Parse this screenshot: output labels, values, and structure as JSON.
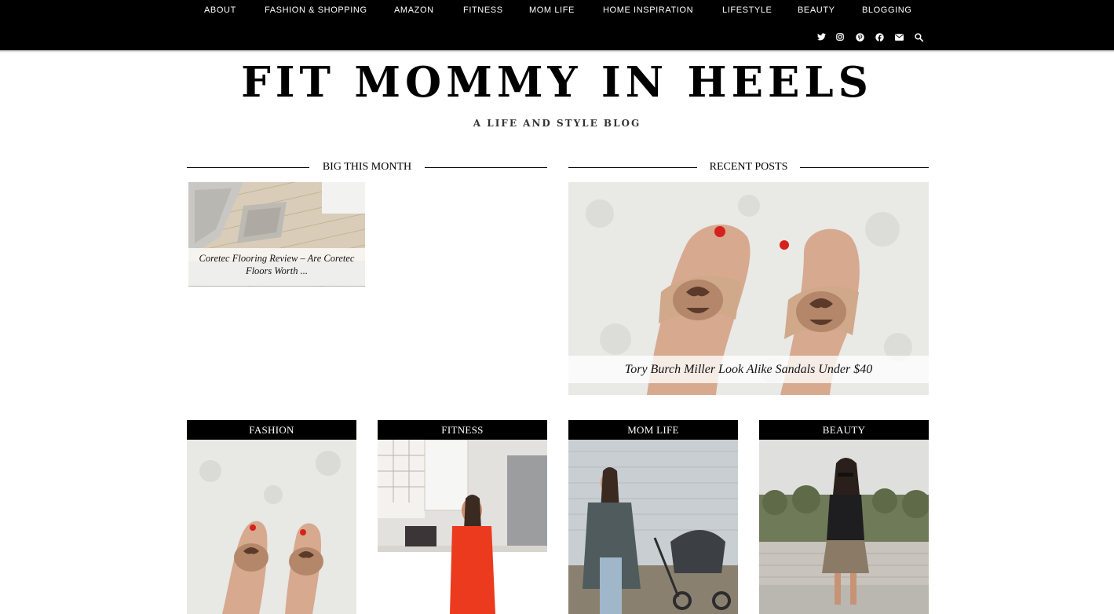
{
  "nav": {
    "items": [
      "ABOUT",
      "FASHION & SHOPPING",
      "AMAZON",
      "FITNESS",
      "MOM LIFE",
      "HOME INSPIRATION",
      "LIFESTYLE",
      "BEAUTY",
      "BLOGGING"
    ],
    "social_icons": [
      "twitter-icon",
      "instagram-icon",
      "pinterest-icon",
      "facebook-icon",
      "email-icon",
      "search-icon"
    ]
  },
  "header": {
    "title": "FIT MOMMY IN HEELS",
    "tagline": "A LIFE AND STYLE BLOG"
  },
  "big_this_month": {
    "heading": "BIG THIS MONTH",
    "posts": [
      {
        "caption": "Coretec Flooring Review – Are Coretec Floors Worth ..."
      }
    ]
  },
  "recent_posts": {
    "heading": "RECENT POSTS",
    "featured": {
      "caption": "Tory Burch Miller Look Alike Sandals Under $40"
    }
  },
  "categories": [
    {
      "label": "FASHION"
    },
    {
      "label": "FITNESS"
    },
    {
      "label": "MOM LIFE"
    },
    {
      "label": "BEAUTY"
    }
  ],
  "colors": {
    "bar": "#000000",
    "background": "#ffffff",
    "text": "#000000"
  }
}
